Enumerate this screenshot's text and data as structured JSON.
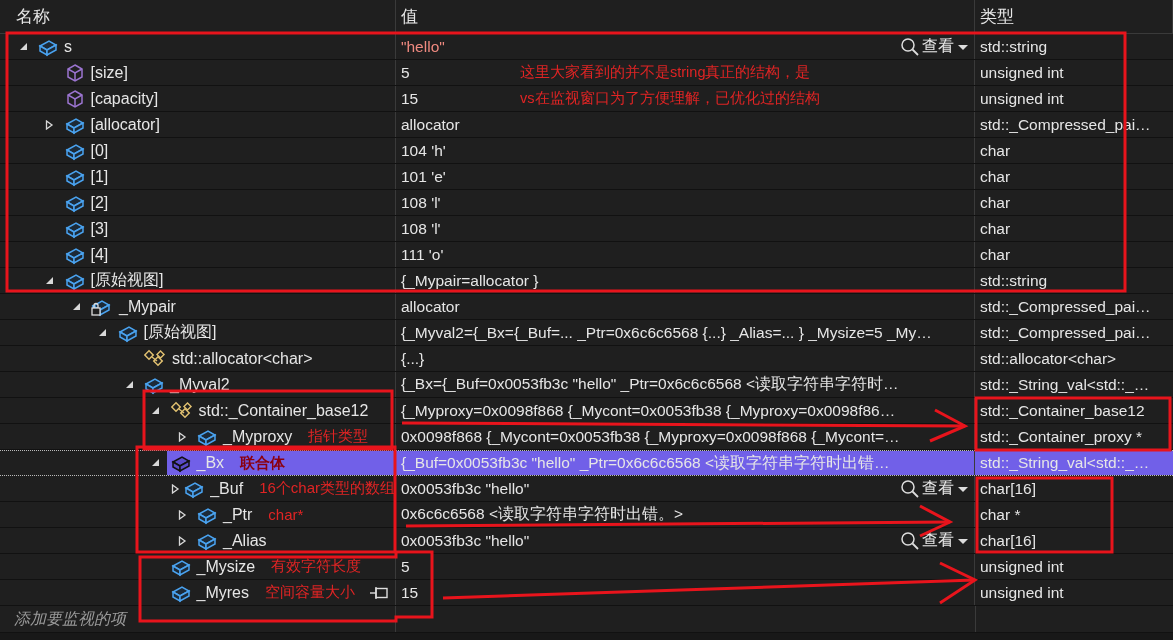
{
  "columns": [
    "名称",
    "值",
    "类型"
  ],
  "rows": [
    {
      "name": "s",
      "value": "\"hello\"",
      "type": "std::string",
      "kind": "field",
      "expanded": true,
      "changed": true,
      "selected": false,
      "pinned": false,
      "view_button": "查看",
      "children": [
        {
          "name": "[size]",
          "value": "5",
          "type": "unsigned int",
          "kind": "property",
          "changed": false,
          "selected": false,
          "pinned": false
        },
        {
          "name": "[capacity]",
          "value": "15",
          "type": "unsigned int",
          "kind": "property",
          "changed": false,
          "selected": false,
          "pinned": false
        },
        {
          "name": "[allocator]",
          "value": "allocator",
          "type": "std::_Compressed_pai…",
          "kind": "field",
          "expanded": false,
          "changed": false,
          "selected": false,
          "pinned": false
        },
        {
          "name": "[0]",
          "value": "104 'h'",
          "type": "char",
          "kind": "field",
          "changed": false,
          "selected": false,
          "pinned": false
        },
        {
          "name": "[1]",
          "value": "101 'e'",
          "type": "char",
          "kind": "field",
          "changed": false,
          "selected": false,
          "pinned": false
        },
        {
          "name": "[2]",
          "value": "108 'l'",
          "type": "char",
          "kind": "field",
          "changed": false,
          "selected": false,
          "pinned": false
        },
        {
          "name": "[3]",
          "value": "108 'l'",
          "type": "char",
          "kind": "field",
          "changed": false,
          "selected": false,
          "pinned": false
        },
        {
          "name": "[4]",
          "value": "111 'o'",
          "type": "char",
          "kind": "field",
          "changed": false,
          "selected": false,
          "pinned": false
        },
        {
          "name": "[原始视图]",
          "value": "{_Mypair=allocator }",
          "type": "std::string",
          "kind": "field",
          "expanded": true,
          "changed": false,
          "selected": false,
          "pinned": false,
          "children": [
            {
              "name": "_Mypair",
              "value": "allocator",
              "type": "std::_Compressed_pai…",
              "kind": "private",
              "expanded": true,
              "changed": false,
              "selected": false,
              "pinned": false,
              "children": [
                {
                  "name": "[原始视图]",
                  "value": "{_Myval2={_Bx={_Buf=... _Ptr=0x6c6c6568 {...} _Alias=... } _Mysize=5 _My…",
                  "type": "std::_Compressed_pai…",
                  "kind": "field",
                  "expanded": true,
                  "changed": false,
                  "selected": false,
                  "pinned": false,
                  "children": [
                    {
                      "name": "std::allocator<char>",
                      "value": "{...}",
                      "type": "std::allocator<char>",
                      "kind": "base",
                      "changed": false,
                      "selected": false,
                      "pinned": false
                    },
                    {
                      "name": "_Myval2",
                      "value": "{_Bx={_Buf=0x0053fb3c \"hello\" _Ptr=0x6c6c6568 <读取字符串字符时…",
                      "type": "std::_String_val<std::_…",
                      "kind": "field",
                      "expanded": true,
                      "changed": false,
                      "selected": false,
                      "pinned": false,
                      "children": [
                        {
                          "name": "std::_Container_base12",
                          "value": "{_Myproxy=0x0098f868 {_Mycont=0x0053fb38 {_Myproxy=0x0098f86…",
                          "type": "std::_Container_base12",
                          "kind": "base",
                          "expanded": true,
                          "changed": false,
                          "selected": false,
                          "pinned": false,
                          "children": [
                            {
                              "name": "_Myproxy",
                              "note": "指针类型",
                              "value": "0x0098f868 {_Mycont=0x0053fb38 {_Myproxy=0x0098f868 {_Mycont=…",
                              "type": "std::_Container_proxy *",
                              "kind": "field",
                              "expanded": false,
                              "changed": false,
                              "selected": false,
                              "pinned": false
                            }
                          ]
                        },
                        {
                          "name": "_Bx",
                          "note": "联合体",
                          "value": "{_Buf=0x0053fb3c \"hello\" _Ptr=0x6c6c6568 <读取字符串字符时出错…",
                          "type": "std::_String_val<std::_…",
                          "kind": "field",
                          "expanded": true,
                          "changed": false,
                          "selected": true,
                          "pinned": false,
                          "children": [
                            {
                              "name": "_Buf",
                              "note": "16个char类型的数组",
                              "value": "0x0053fb3c \"hello\"",
                              "type": "char[16]",
                              "kind": "field",
                              "expanded": false,
                              "changed": false,
                              "selected": false,
                              "pinned": false,
                              "view_button": "查看"
                            },
                            {
                              "name": "_Ptr",
                              "note": "char*",
                              "value": "0x6c6c6568 <读取字符串字符时出错。>",
                              "type": "char *",
                              "kind": "field",
                              "expanded": false,
                              "changed": false,
                              "selected": false,
                              "pinned": false
                            },
                            {
                              "name": "_Alias",
                              "value": "0x0053fb3c \"hello\"",
                              "type": "char[16]",
                              "kind": "field",
                              "expanded": false,
                              "changed": false,
                              "selected": false,
                              "pinned": false,
                              "view_button": "查看"
                            }
                          ]
                        },
                        {
                          "name": "_Mysize",
                          "note": "有效字符长度",
                          "value": "5",
                          "type": "unsigned int",
                          "kind": "field",
                          "changed": false,
                          "selected": false,
                          "pinned": false
                        },
                        {
                          "name": "_Myres",
                          "note": "空间容量大小",
                          "value": "15",
                          "type": "unsigned int",
                          "kind": "field",
                          "changed": false,
                          "selected": false,
                          "pinned": true
                        }
                      ]
                    }
                  ]
                }
              ]
            }
          ]
        }
      ]
    }
  ],
  "add_item": {
    "placeholder": "添加要监视的项"
  },
  "annotation": [
    "这里大家看到的并不是string真正的结构，是",
    "vs在监视窗口为了方便理解，已优化过的结构"
  ]
}
